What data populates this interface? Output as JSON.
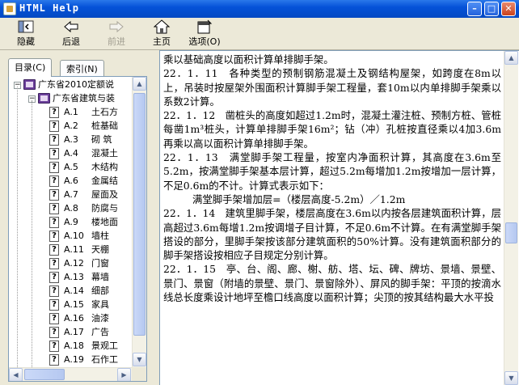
{
  "window": {
    "title": "HTML Help"
  },
  "toolbar": {
    "hide_label": "隐藏",
    "back_label": "后退",
    "forward_label": "前进",
    "home_label": "主页",
    "options_label": "选项(O)"
  },
  "tabs": {
    "contents": "目录(C)",
    "index": "索引(N)"
  },
  "tree": {
    "root": "广东省2010定额说",
    "folder": "广东省建筑与装",
    "items": [
      {
        "code": "A.1",
        "name": "土石方"
      },
      {
        "code": "A.2",
        "name": "桩基础"
      },
      {
        "code": "A.3",
        "name": "砌 筑"
      },
      {
        "code": "A.4",
        "name": "混凝土"
      },
      {
        "code": "A.5",
        "name": "木结构"
      },
      {
        "code": "A.6",
        "name": "金属结"
      },
      {
        "code": "A.7",
        "name": "屋面及"
      },
      {
        "code": "A.8",
        "name": "防腐与"
      },
      {
        "code": "A.9",
        "name": "楼地面"
      },
      {
        "code": "A.10",
        "name": "墙柱"
      },
      {
        "code": "A.11",
        "name": "天棚"
      },
      {
        "code": "A.12",
        "name": "门窗"
      },
      {
        "code": "A.13",
        "name": "幕墙"
      },
      {
        "code": "A.14",
        "name": "细部"
      },
      {
        "code": "A.15",
        "name": "家具"
      },
      {
        "code": "A.16",
        "name": "油漆"
      },
      {
        "code": "A.17",
        "name": "广告"
      },
      {
        "code": "A.18",
        "name": "景观工"
      },
      {
        "code": "A.19",
        "name": "石作工"
      }
    ]
  },
  "content": {
    "paragraphs": [
      "乘以基础高度以面积计算单排脚手架。",
      "22．1．11　各种类型的预制钢筋混凝土及钢结构屋架，如跨度在8m以上，吊装时按屋架外围面积计算脚手架工程量，套10m以内单排脚手架乘以系数2计算。",
      "22．1．12　凿桩头的高度如超过1.2m时，混凝土灌注桩、预制方桩、管桩每凿1m³桩头，计算单排脚手架16m²；钻（冲）孔桩按直径乘以4加3.6m再乘以高以面积计算单排脚手架。",
      "22．1．13　满堂脚手架工程量，按室内净面积计算，其高度在3.6m至5.2m，按满堂脚手架基本层计算，超过5.2m每增加1.2m按增加一层计算，不足0.6m的不计。计算式表示如下：",
      "满堂脚手架增加层=（楼层高度-5.2m）／1.2m",
      "22．1．14　建筑里脚手架，楼层高度在3.6m以内按各层建筑面积计算，层高超过3.6m每增1.2m按调增子目计算，不足0.6m不计算。在有满堂脚手架搭设的部分，里脚手架按该部分建筑面积的50%计算。没有建筑面积部分的脚手架搭设按相应子目规定分别计算。",
      "22．1．15　亭、台、阁、廊、榭、舫、塔、坛、碑、牌坊、景墙、景壁、景门、景窗（附墙的景壁、景门、景窗除外）、屏风的脚手架：平顶的按滴水线总长度乘设计地坪至檐口线高度以面积计算；尖顶的按其结构最大水平投"
    ]
  },
  "colors": {
    "annotation": "#e8212b",
    "titlebar": "#0552d8"
  }
}
